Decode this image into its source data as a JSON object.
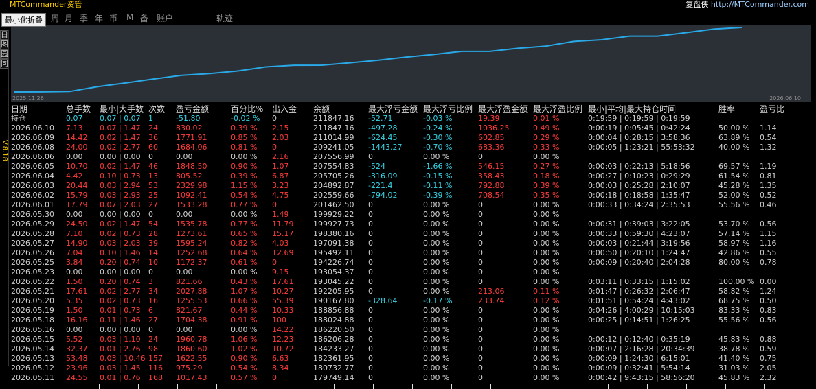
{
  "app": {
    "title": "MTCommander资管",
    "right_prefix": "复盘侠",
    "right_url": "http://MTCommander.com"
  },
  "tooltip": "最小化折叠",
  "nav": {
    "tabs": [
      "周",
      "月",
      "季",
      "年",
      "币",
      "M",
      "备",
      "账户",
      "轨迹"
    ]
  },
  "left_tabs": [
    "日",
    "图",
    "园",
    "同"
  ],
  "version": "V.8.18",
  "chart_data": {
    "type": "line",
    "x_start": "2025.11.26",
    "x_end": "2026.06.10",
    "series": [
      {
        "values": [
          179749.14,
          179800,
          180000,
          182361.95,
          184233.27,
          186206.28,
          188024.88,
          188856.88,
          190167.8,
          192205.95,
          193045.22,
          193054.37,
          194226.74,
          195492.11,
          197091.38,
          198380.16,
          199927.73,
          199929.22,
          201462.5,
          202559.66,
          204892.87,
          205705.26,
          207554.83,
          207556.99,
          209241.05,
          211014.99,
          211847.16
        ]
      }
    ],
    "line_color": "#29a9e8"
  },
  "table": {
    "headers": [
      "日期",
      "总手数",
      "最小|大手数",
      "次数",
      "盈亏金额",
      "百分比%",
      "出入金",
      "余额",
      "最大浮亏金额",
      "最大浮亏比例",
      "最大浮盈金额",
      "最大浮盈比例",
      "最小|平均|最大持仓时间",
      "胜率",
      "盈亏比"
    ],
    "holding": [
      "持仓",
      "0.07",
      "0.07 | 0.07",
      "1",
      "-51.80",
      "-0.02 %",
      "0",
      "211847.16",
      "-52.71",
      "-0.03 %",
      "19.39",
      "0.01 %",
      "0:19:59 | 0:19:59 | 0:19:59",
      "",
      ""
    ],
    "rows": [
      [
        "2026.06.10",
        "7.13",
        "0.07 | 1.47",
        "24",
        "830.02",
        "0.39 %",
        "2.15",
        "211847.16",
        "-497.28",
        "-0.24 %",
        "1036.25",
        "0.49 %",
        "0:00:19 | 0:05:45 | 0:42:24",
        "50.00 %",
        "1.14"
      ],
      [
        "2026.06.09",
        "14.42",
        "0.02 | 1.47",
        "36",
        "1771.91",
        "0.85 %",
        "2.03",
        "211014.99",
        "-624.45",
        "-0.30 %",
        "602.85",
        "0.29 %",
        "0:00:04 | 0:28:15 | 3:58:36",
        "63.89 %",
        "0.54"
      ],
      [
        "2026.06.08",
        "24.00",
        "0.02 | 2.77",
        "60",
        "1684.06",
        "0.81 %",
        "0",
        "209241.05",
        "-1443.27",
        "-0.70 %",
        "683.36",
        "0.33 %",
        "0:00:05 | 1:23:21 | 55:53:32",
        "40.00 %",
        "1.32"
      ],
      [
        "2026.06.06",
        "0.00",
        "0.00 | 0.00",
        "0",
        "0.00",
        "0.00 %",
        "2.16",
        "207556.99",
        "0",
        "0.00 %",
        "0",
        "0.00 %",
        "",
        "",
        ""
      ],
      [
        "2026.06.05",
        "10.70",
        "0.02 | 1.47",
        "46",
        "1848.50",
        "0.90 %",
        "1.07",
        "207554.83",
        "-524",
        "-1.66 %",
        "546.15",
        "0.27 %",
        "0:00:03 | 0:22:13 | 5:18:56",
        "69.57 %",
        "1.19"
      ],
      [
        "2026.06.04",
        "4.42",
        "0.10 | 0.73",
        "13",
        "805.52",
        "0.39 %",
        "6.87",
        "205705.26",
        "-316.09",
        "-0.15 %",
        "358.43",
        "0.18 %",
        "0:00:27 | 0:10:23 | 0:29:29",
        "61.54 %",
        "0.81"
      ],
      [
        "2026.06.03",
        "20.44",
        "0.03 | 2.94",
        "53",
        "2329.98",
        "1.15 %",
        "3.23",
        "204892.87",
        "-221.4",
        "-0.11 %",
        "792.88",
        "0.39 %",
        "0:00:03 | 0:25:28 | 2:10:07",
        "45.28 %",
        "1.35"
      ],
      [
        "2026.06.02",
        "15.79",
        "0.03 | 2.93",
        "25",
        "1092.41",
        "0.54 %",
        "4.75",
        "202559.66",
        "-794.02",
        "-0.39 %",
        "708.54",
        "0.35 %",
        "0:00:18 | 0:18:58 | 1:35:47",
        "52.00 %",
        "0.52"
      ],
      [
        "2026.06.01",
        "17.79",
        "0.07 | 2.03",
        "27",
        "1533.28",
        "0.77 %",
        "0",
        "201462.50",
        "0",
        "0.00 %",
        "0",
        "0.00 %",
        "0:00:33 | 0:34:24 | 2:35:53",
        "55.56 %",
        "0.46"
      ],
      [
        "2026.05.30",
        "0.00",
        "0.00 | 0.00",
        "0",
        "0.00",
        "0.00 %",
        "1.49",
        "199929.22",
        "0",
        "0.00 %",
        "0",
        "0.00 %",
        "",
        "",
        ""
      ],
      [
        "2026.05.29",
        "24.50",
        "0.02 | 1.47",
        "54",
        "1535.78",
        "0.77 %",
        "11.79",
        "199927.73",
        "0",
        "0.00 %",
        "0",
        "0.00 %",
        "0:00:31 | 0:39:03 | 3:22:05",
        "53.70 %",
        "0.56"
      ],
      [
        "2026.05.28",
        "7.10",
        "0.02 | 0.73",
        "28",
        "1273.61",
        "0.65 %",
        "15.17",
        "198380.16",
        "0",
        "0.00 %",
        "0",
        "0.00 %",
        "0:00:33 | 0:59:30 | 4:23:07",
        "57.14 %",
        "1.15"
      ],
      [
        "2026.05.27",
        "14.90",
        "0.03 | 2.03",
        "39",
        "1595.24",
        "0.82 %",
        "4.03",
        "197091.38",
        "0",
        "0.00 %",
        "0",
        "0.00 %",
        "0:00:03 | 0:21:44 | 3:19:56",
        "58.97 %",
        "1.16"
      ],
      [
        "2026.05.26",
        "7.04",
        "0.10 | 1.46",
        "14",
        "1252.68",
        "0.64 %",
        "12.69",
        "195492.11",
        "0",
        "0.00 %",
        "0",
        "0.00 %",
        "0:00:50 | 0:20:10 | 1:24:47",
        "42.86 %",
        "0.55"
      ],
      [
        "2026.05.25",
        "3.84",
        "0.20 | 0.74",
        "10",
        "1172.37",
        "0.61 %",
        "0",
        "194226.74",
        "0",
        "0.00 %",
        "0",
        "0.00 %",
        "0:00:09 | 0:20:40 | 2:04:28",
        "80.00 %",
        "0.78"
      ],
      [
        "2026.05.23",
        "0.00",
        "0.00 | 0.00",
        "0",
        "0.00",
        "0.00 %",
        "9.15",
        "193054.37",
        "0",
        "0.00 %",
        "0",
        "0.00 %",
        "",
        "",
        ""
      ],
      [
        "2026.05.22",
        "1.50",
        "0.20 | 0.74",
        "3",
        "821.66",
        "0.43 %",
        "17.61",
        "193045.22",
        "0",
        "0.00 %",
        "0",
        "0.00 %",
        "0:03:11 | 0:33:15 | 1:15:02",
        "100.00 %",
        "0.00"
      ],
      [
        "2026.05.21",
        "17.61",
        "0.02 | 2.77",
        "34",
        "2027.88",
        "1.07 %",
        "10.27",
        "192205.95",
        "0",
        "0.00 %",
        "213.06",
        "0.11 %",
        "0:01:47 | 0:26:32 | 2:06:47",
        "58.82 %",
        "1.24"
      ],
      [
        "2026.05.20",
        "5.35",
        "0.02 | 0.73",
        "16",
        "1255.53",
        "0.66 %",
        "55.39",
        "190167.80",
        "-328.64",
        "-0.17 %",
        "233.74",
        "0.12 %",
        "0:01:51 | 0:54:24 | 4:43:02",
        "68.75 %",
        "0.50"
      ],
      [
        "2026.05.19",
        "1.50",
        "0.01 | 0.73",
        "6",
        "821.67",
        "0.44 %",
        "10.33",
        "188856.88",
        "0",
        "0.00 %",
        "0",
        "0.00 %",
        "0:04:26 | 4:00:29 | 10:15:03",
        "83.33 %",
        "0.83"
      ],
      [
        "2026.05.18",
        "16.16",
        "0.11 | 1.46",
        "27",
        "1704.38",
        "0.91 %",
        "100",
        "188024.88",
        "0",
        "0.00 %",
        "0",
        "0.00 %",
        "0:00:25 | 0:14:51 | 1:26:25",
        "55.56 %",
        "0.56"
      ],
      [
        "2026.05.16",
        "0.00",
        "0.00 | 0.00",
        "0",
        "0.00",
        "0.00 %",
        "14.22",
        "186220.50",
        "0",
        "0.00 %",
        "0",
        "0.00 %",
        "",
        "",
        ""
      ],
      [
        "2026.05.15",
        "5.52",
        "0.03 | 1.10",
        "24",
        "1960.78",
        "1.06 %",
        "12.23",
        "186206.28",
        "0",
        "0.00 %",
        "0",
        "0.00 %",
        "0:00:12 | 0:12:40 | 0:35:19",
        "45.83 %",
        "0.88"
      ],
      [
        "2026.05.14",
        "32.37",
        "0.01 | 2.76",
        "98",
        "1860.60",
        "1.02 %",
        "10.72",
        "184233.27",
        "0",
        "0.00 %",
        "0",
        "0.00 %",
        "0:00:07 | 2:16:28 | 20:34:39",
        "38.78 %",
        "0.59"
      ],
      [
        "2026.05.13",
        "53.48",
        "0.03 | 10.46",
        "157",
        "1622.55",
        "0.90 %",
        "6.63",
        "182361.95",
        "0",
        "0.00 %",
        "0",
        "0.00 %",
        "0:00:09 | 1:24:30 | 6:15:01",
        "41.40 %",
        "0.75"
      ],
      [
        "2026.05.12",
        "23.96",
        "0.03 | 1.45",
        "116",
        "975.29",
        "0.54 %",
        "8.34",
        "180732.77",
        "0",
        "0.00 %",
        "0",
        "0.00 %",
        "0:00:09 | 0:32:41 | 5:54:14",
        "31.03 %",
        "2.05"
      ],
      [
        "2026.05.11",
        "24.55",
        "0.01 | 0.76",
        "168",
        "1017.43",
        "0.57 %",
        "0",
        "179749.14",
        "0",
        "0.00 %",
        "0",
        "0.00 %",
        "0:00:42 | 9:43:15 | 58:56:20",
        "45.83 %",
        "2.32"
      ]
    ]
  }
}
